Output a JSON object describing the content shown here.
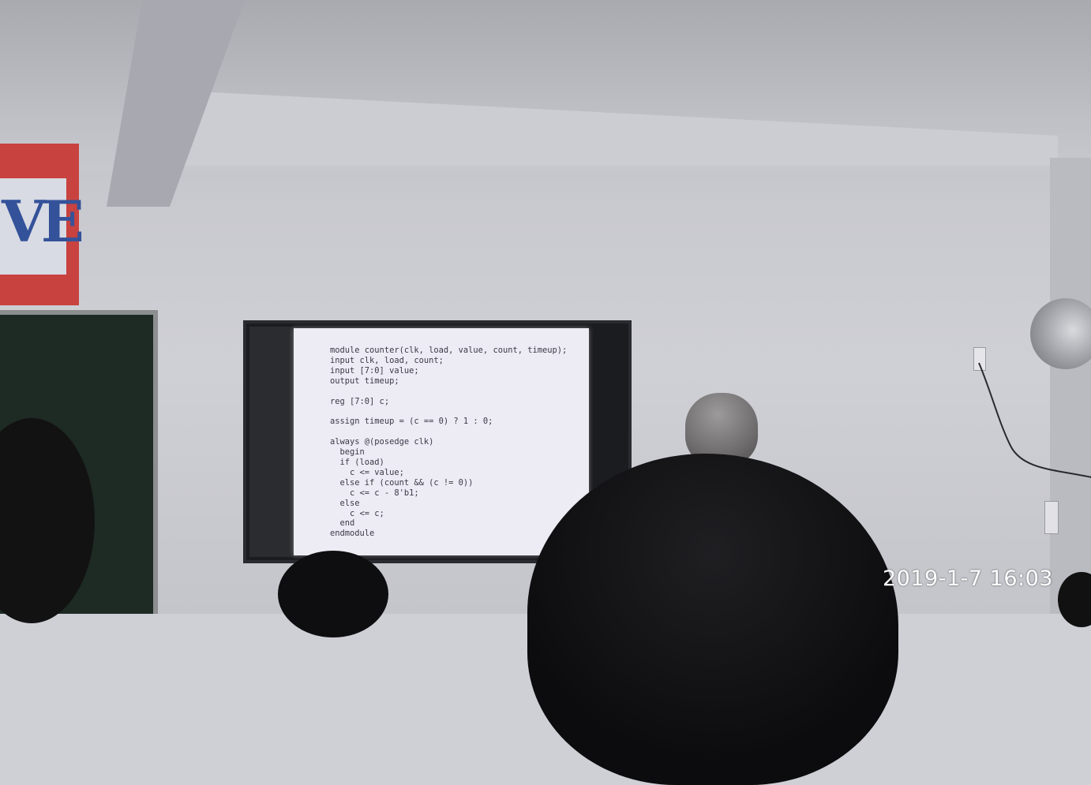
{
  "photo": {
    "slide_code_lines": [
      "module counter(clk, load, value, count, timeup);",
      "input clk, load, count;",
      "input [7:0] value;",
      "output timeup;",
      "",
      "reg [7:0] c;",
      "",
      "assign timeup = (c == 0) ? 1 : 0;",
      "",
      "always @(posedge clk)",
      "  begin",
      "  if (load)",
      "    c <= value;",
      "  else if (count && (c != 0))",
      "    c <= c - 8'b1;",
      "  else",
      "    c <= c;",
      "  end",
      "endmodule"
    ],
    "timestamp": "2019-1-7 16:03",
    "banner_logo_text": "VE"
  },
  "colors": {
    "wall": "#cfd0d6",
    "slide_background": "#edebf3",
    "banner_red": "#c8423f",
    "blackboard": "#1e2a24",
    "tv_frame": "#1b1c20"
  }
}
